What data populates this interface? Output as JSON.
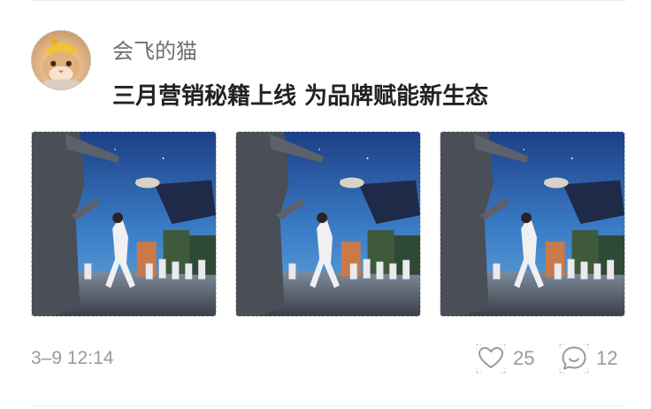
{
  "post": {
    "username": "会飞的猫",
    "text": "三月营销秘籍上线 为品牌赋能新生态",
    "timestamp": "3–9 12:14",
    "likes": "25",
    "comments": "12"
  },
  "photos": [
    {
      "name": "photo-1"
    },
    {
      "name": "photo-2"
    },
    {
      "name": "photo-3"
    }
  ],
  "icons": {
    "like": "heart-icon",
    "comment": "comment-bubble-icon"
  },
  "colors": {
    "username": "#6f6f6f",
    "text": "#222222",
    "meta": "#9a9a9a"
  }
}
